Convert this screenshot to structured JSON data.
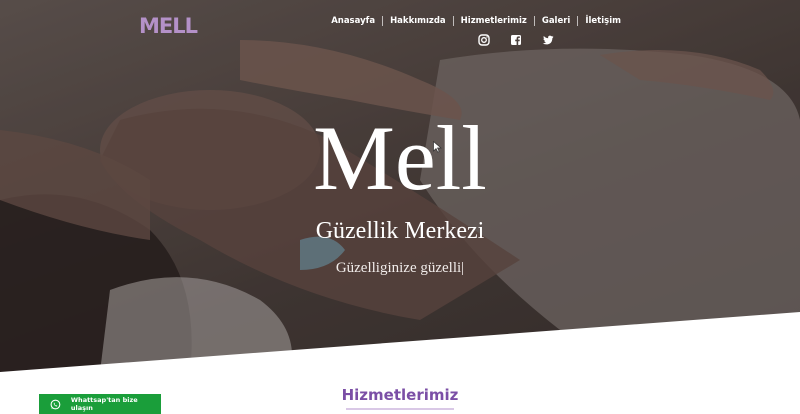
{
  "brand": {
    "logo_text": "MELL"
  },
  "nav": {
    "items": [
      "Anasayfa",
      "Hakkımızda",
      "Hizmetlerimiz",
      "Galeri",
      "İletişim"
    ]
  },
  "social": {
    "icons": [
      "instagram-icon",
      "facebook-icon",
      "twitter-icon"
    ]
  },
  "hero": {
    "title": "Mell",
    "subtitle": "Güzellik Merkezi",
    "tagline": "Güzelliginize güzelli|"
  },
  "services": {
    "title": "Hizmetlerimiz"
  },
  "whatsapp": {
    "label": "Whattsap'tan bize ulaşın"
  },
  "colors": {
    "accent_purple": "#7b4fa6",
    "logo_purple": "#b491c8",
    "whatsapp_green": "#1a9e3a"
  }
}
